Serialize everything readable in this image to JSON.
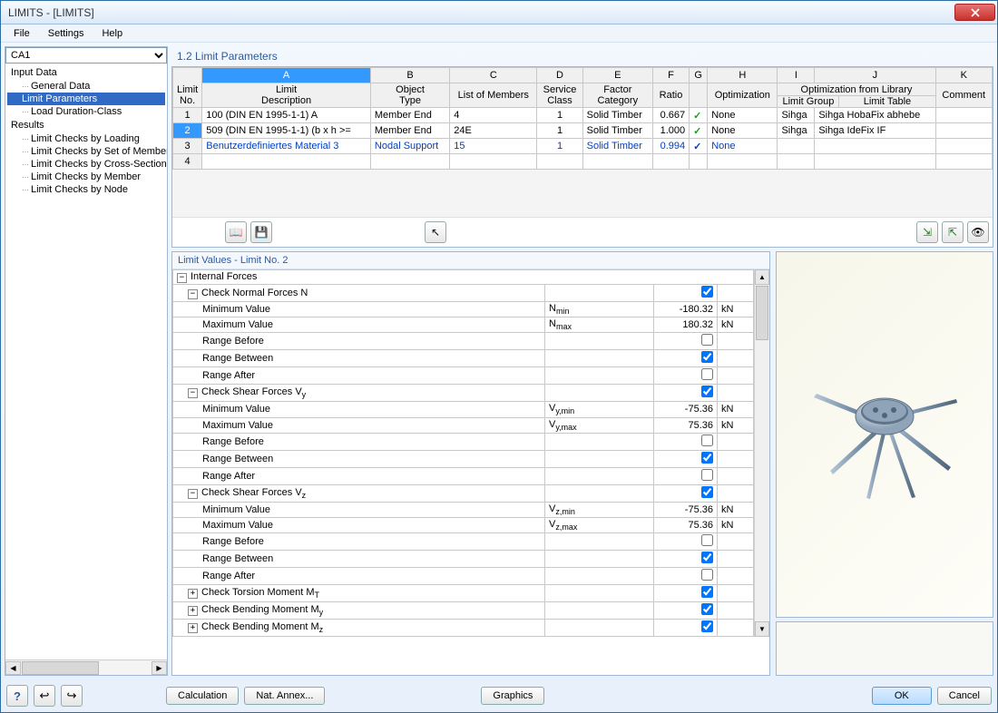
{
  "window": {
    "title": "LIMITS - [LIMITS]"
  },
  "menu": {
    "file": "File",
    "settings": "Settings",
    "help": "Help"
  },
  "sidebar": {
    "combo": "CA1",
    "tree": {
      "input_data": "Input Data",
      "general_data": "General Data",
      "limit_parameters": "Limit Parameters",
      "load_duration": "Load Duration-Class",
      "results": "Results",
      "checks_loading": "Limit Checks by Loading",
      "checks_set": "Limit Checks by Set of Members",
      "checks_cs": "Limit Checks by Cross-Section",
      "checks_member": "Limit Checks by Member",
      "checks_node": "Limit Checks by Node"
    }
  },
  "section_title": "1.2 Limit Parameters",
  "grid": {
    "headers": {
      "limit_no": "Limit\nNo.",
      "A": "A",
      "B": "B",
      "C": "C",
      "D": "D",
      "E": "E",
      "F": "F",
      "G": "G",
      "H": "H",
      "I": "I",
      "J": "J",
      "K": "K",
      "desc": "Limit\nDescription",
      "obj_type": "Object\nType",
      "list": "List of Members",
      "service": "Service\nClass",
      "factor": "Factor\nCategory",
      "ratio": "Ratio",
      "opt": "Optimization",
      "opt_lib": "Optimization from Library",
      "lgroup": "Limit Group",
      "ltable": "Limit Table",
      "comment": "Comment"
    },
    "rows": [
      {
        "no": "1",
        "desc": "100 (DIN EN 1995-1-1) A",
        "type": "Member End",
        "list": "4",
        "service": "1",
        "factor": "Solid Timber",
        "ratio": "0.667",
        "g": "✓",
        "opt": "None",
        "lgroup": "Sihga",
        "ltable": "Sihga HobaFix abhebe",
        "blue": false
      },
      {
        "no": "2",
        "desc": "509 (DIN EN 1995-1-1) (b x h >=",
        "type": "Member End",
        "list": "24E",
        "service": "1",
        "factor": "Solid Timber",
        "ratio": "1.000",
        "g": "✓",
        "opt": "None",
        "lgroup": "Sihga",
        "ltable": "Sihga IdeFix IF",
        "blue": false,
        "sel": true
      },
      {
        "no": "3",
        "desc": "Benutzerdefiniertes Material 3",
        "type": "Nodal Support",
        "list": "15",
        "service": "1",
        "factor": "Solid Timber",
        "ratio": "0.994",
        "g": "✓",
        "opt": "None",
        "lgroup": "",
        "ltable": "",
        "blue": true
      },
      {
        "no": "4",
        "desc": "",
        "type": "",
        "list": "",
        "service": "",
        "factor": "",
        "ratio": "",
        "g": "",
        "opt": "",
        "lgroup": "",
        "ltable": "",
        "blue": false
      }
    ]
  },
  "detail": {
    "title": "Limit Values - Limit No. 2",
    "internal_forces": "Internal Forces",
    "check_n": "Check Normal Forces N",
    "min_val": "Minimum Value",
    "max_val": "Maximum Value",
    "range_before": "Range Before",
    "range_between": "Range Between",
    "range_after": "Range After",
    "check_vy": "Check Shear Forces V",
    "check_vz": "Check Shear Forces V",
    "check_mt": "Check Torsion Moment M",
    "check_my": "Check Bending Moment M",
    "check_mz": "Check Bending Moment M",
    "n_min_sym": "N",
    "n_min_sub": "min",
    "n_min_val": "-180.32",
    "n_min_unit": "kN",
    "n_max_sym": "N",
    "n_max_sub": "max",
    "n_max_val": "180.32",
    "n_max_unit": "kN",
    "vy_min_sym": "V",
    "vy_min_sub": "y,min",
    "vy_min_val": "-75.36",
    "vy_min_unit": "kN",
    "vy_max_sym": "V",
    "vy_max_sub": "y,max",
    "vy_max_val": "75.36",
    "vy_max_unit": "kN",
    "vz_min_sym": "V",
    "vz_min_sub": "z,min",
    "vz_min_val": "-75.36",
    "vz_min_unit": "kN",
    "vz_max_sym": "V",
    "vz_max_sub": "z,max",
    "vz_max_val": "75.36",
    "vz_max_unit": "kN"
  },
  "buttons": {
    "calculation": "Calculation",
    "nat_annex": "Nat. Annex...",
    "graphics": "Graphics",
    "ok": "OK",
    "cancel": "Cancel"
  }
}
